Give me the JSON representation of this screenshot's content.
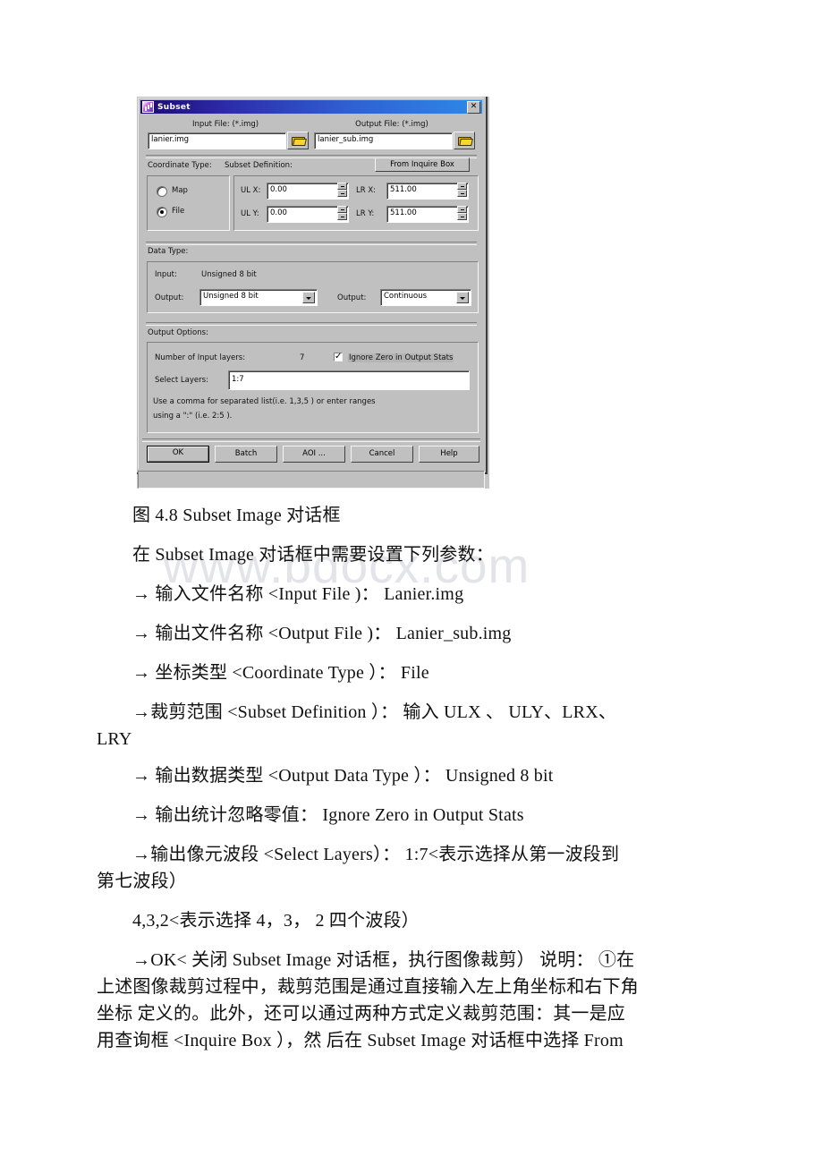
{
  "watermark": "www.bdocx.com",
  "dialog": {
    "title": "Subset",
    "title_icon": "app-icon",
    "close_label": "✕",
    "input_file_label": "Input File: (*.img)",
    "output_file_label": "Output File: (*.img)",
    "input_file_value": "lanier.img",
    "output_file_value": "lanier_sub.img",
    "coordinate_type_label": "Coordinate Type:",
    "subset_definition_label": "Subset Definition:",
    "from_inquire_box_label": "From Inquire Box",
    "coord_options": [
      {
        "label": "Map",
        "selected": false
      },
      {
        "label": "File",
        "selected": true
      }
    ],
    "coords": [
      {
        "label": "UL X:",
        "value": "0.00"
      },
      {
        "label": "LR X:",
        "value": "511.00"
      },
      {
        "label": "UL Y:",
        "value": "0.00"
      },
      {
        "label": "LR Y:",
        "value": "511.00"
      }
    ],
    "data_type_label": "Data Type:",
    "data_type_input_label": "Input:",
    "data_type_input_value": "Unsigned 8 bit",
    "data_type_output_label": "Output:",
    "data_type_output_value": "Unsigned 8 bit",
    "data_type_output2_label": "Output:",
    "data_type_output2_value": "Continuous",
    "output_options_label": "Output Options:",
    "num_input_layers_label": "Number of Input layers:",
    "num_input_layers_value": "7",
    "ignore_zero_label": "Ignore Zero in Output Stats",
    "ignore_zero_checked": true,
    "select_layers_label": "Select Layers:",
    "select_layers_value": "1:7",
    "hint_line1": "Use a comma for separated list(i.e. 1,3,5 ) or enter ranges",
    "hint_line2": "using a \":\" (i.e. 2:5 ).",
    "buttons": [
      {
        "label": "OK",
        "default": true
      },
      {
        "label": "Batch",
        "default": false
      },
      {
        "label": "AOI ...",
        "default": false
      },
      {
        "label": "Cancel",
        "default": false
      },
      {
        "label": "Help",
        "default": false
      }
    ]
  },
  "document": {
    "caption": "图 4.8 Subset Image 对话框",
    "intro": "在 Subset Image 对话框中需要设置下列参数：",
    "line_input": "→ 输入文件名称 <Input File )：  Lanier.img",
    "line_output": "→ 输出文件名称 <Output File )：  Lanier_sub.img",
    "line_coord": "→ 坐标类型 <Coordinate Type ）：  File",
    "line_subset": "→裁剪范围 <Subset Definition ）： 输入 ULX 、 ULY、LRX、",
    "line_subset_cont": "LRY",
    "line_datatype": "→ 输出数据类型 <Output Data Type ）：  Unsigned 8 bit",
    "line_ignorezero": "→ 输出统计忽略零值：  Ignore Zero in Output Stats",
    "line_layers": "→输出像元波段 <Select Layers）：  1:7<表示选择从第一波段到",
    "line_layers_cont": "第七波段）",
    "line_432": "4,3,2<表示选择 4，3， 2 四个波段）",
    "line_ok": "→OK< 关闭 Subset Image 对话框，执行图像裁剪） 说明： ①在",
    "line_ok_2": "上述图像裁剪过程中，裁剪范围是通过直接输入左上角坐标和右下角",
    "line_ok_3": "坐标 定义的。此外，还可以通过两种方式定义裁剪范围：其一是应",
    "line_ok_4": "用查询框 <Inquire Box ），然 后在 Subset Image 对话框中选择 From"
  }
}
